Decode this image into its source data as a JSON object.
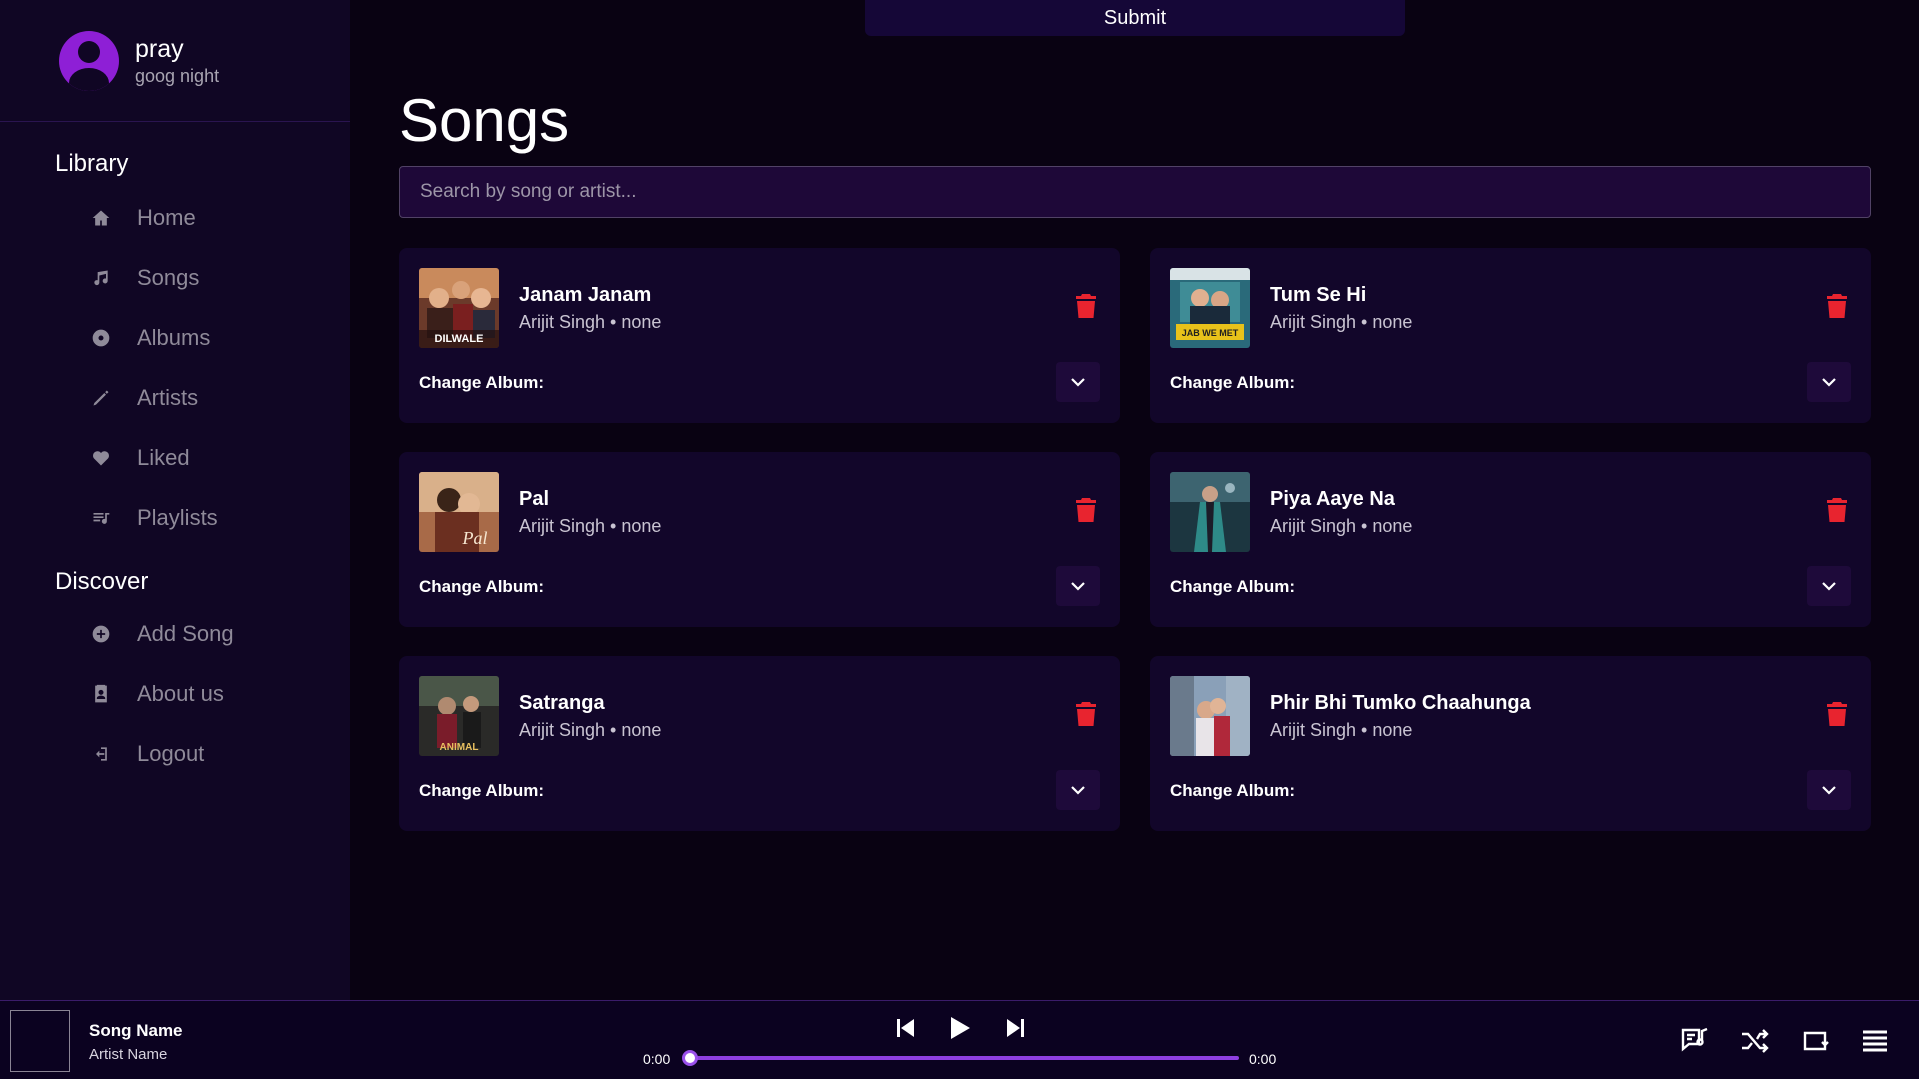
{
  "profile": {
    "name": "pray",
    "status": "goog night"
  },
  "sidebar": {
    "library_title": "Library",
    "library_items": [
      {
        "label": "Home",
        "icon": "home-icon"
      },
      {
        "label": "Songs",
        "icon": "music-note-icon"
      },
      {
        "label": "Albums",
        "icon": "disc-icon"
      },
      {
        "label": "Artists",
        "icon": "pen-icon"
      },
      {
        "label": "Liked",
        "icon": "heart-icon"
      },
      {
        "label": "Playlists",
        "icon": "playlist-icon"
      }
    ],
    "discover_title": "Discover",
    "discover_items": [
      {
        "label": "Add Song",
        "icon": "plus-circle-icon"
      },
      {
        "label": "About us",
        "icon": "contact-card-icon"
      },
      {
        "label": "Logout",
        "icon": "logout-icon"
      }
    ]
  },
  "topbar": {
    "submit_label": "Submit"
  },
  "main": {
    "title": "Songs",
    "search_placeholder": "Search by song or artist...",
    "change_album_label": "Change Album:",
    "songs": [
      {
        "title": "Janam Janam",
        "subtitle": "Arijit Singh • none",
        "cover_text": "DILWALE"
      },
      {
        "title": "Tum Se Hi",
        "subtitle": "Arijit Singh • none",
        "cover_text": "JAB WE MET"
      },
      {
        "title": "Pal",
        "subtitle": "Arijit Singh • none",
        "cover_text": "Pal"
      },
      {
        "title": "Piya Aaye Na",
        "subtitle": "Arijit Singh • none",
        "cover_text": ""
      },
      {
        "title": "Satranga",
        "subtitle": "Arijit Singh • none",
        "cover_text": "ANIMAL"
      },
      {
        "title": "Phir Bhi Tumko Chaahunga",
        "subtitle": "Arijit Singh • none",
        "cover_text": ""
      }
    ]
  },
  "player": {
    "song_name": "Song Name",
    "artist_name": "Artist Name",
    "current_time": "0:00",
    "total_time": "0:00",
    "progress": 0
  },
  "colors": {
    "accent": "#8e1fd6",
    "delete": "#e8242f",
    "background": "#090212",
    "sidebar": "#100624"
  }
}
